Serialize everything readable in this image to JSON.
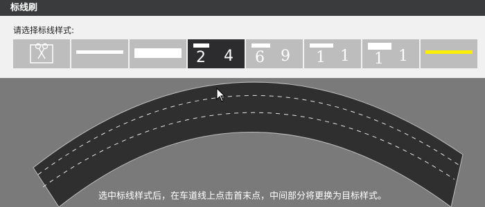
{
  "window": {
    "title": "标线刷"
  },
  "panel": {
    "prompt": "请选择标线样式:"
  },
  "styles": [
    {
      "name": "clear",
      "icon": "scissors-icon"
    },
    {
      "name": "thin-solid"
    },
    {
      "name": "thick-solid"
    },
    {
      "name": "dash-2-4",
      "left": "2",
      "right": "4",
      "selected": true
    },
    {
      "name": "dash-6-9",
      "left": "6",
      "right": "9"
    },
    {
      "name": "dash-1-1",
      "left": "1",
      "right": "1"
    },
    {
      "name": "dash-1-1-wide",
      "left": "1",
      "right": "1"
    },
    {
      "name": "yellow-solid",
      "color": "#ffee00"
    }
  ],
  "canvas": {
    "hint": "选中标线样式后，在车道线上点击首末点，中间部分将更换为目标样式。"
  }
}
